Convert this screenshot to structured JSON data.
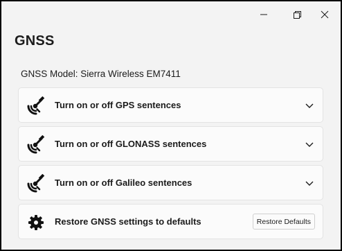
{
  "window": {
    "controls": {
      "minimize_icon": "minimize-icon",
      "maximize_icon": "maximize-icon",
      "close_icon": "close-icon"
    }
  },
  "page": {
    "title": "GNSS",
    "model_label": "GNSS Model: Sierra Wireless EM7411"
  },
  "cards": [
    {
      "label": "Turn on or off GPS sentences",
      "icon": "satellite-icon",
      "action": "expand"
    },
    {
      "label": "Turn on or off GLONASS sentences",
      "icon": "satellite-icon",
      "action": "expand"
    },
    {
      "label": "Turn on or off Galileo sentences",
      "icon": "satellite-icon",
      "action": "expand"
    },
    {
      "label": "Restore GNSS settings to defaults",
      "icon": "gear-icon",
      "button_label": "Restore Defaults"
    }
  ],
  "colors": {
    "window_bg": "#f3f3f3",
    "card_bg": "#fbfbfb",
    "text": "#1b1b1b"
  }
}
